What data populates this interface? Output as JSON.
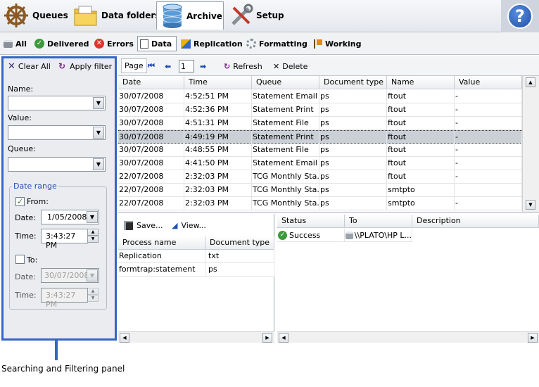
{
  "topbar": {
    "items": [
      {
        "label": "Queues",
        "icon": "ship-wheel-icon"
      },
      {
        "label": "Data folders",
        "icon": "folder-icon"
      },
      {
        "label": "Archive",
        "icon": "database-icon",
        "active": true
      },
      {
        "label": "Setup",
        "icon": "tools-icon"
      }
    ],
    "help_glyph": "?"
  },
  "tabs": [
    {
      "label": "All",
      "icon": "printer-icon"
    },
    {
      "label": "Delivered",
      "icon": "check-icon"
    },
    {
      "label": "Errors",
      "icon": "error-icon"
    },
    {
      "label": "Data",
      "icon": "data-icon",
      "active": true
    },
    {
      "label": "Replication",
      "icon": "replication-icon"
    },
    {
      "label": "Formatting",
      "icon": "gear-icon"
    },
    {
      "label": "Working",
      "icon": "flag-icon"
    }
  ],
  "filter": {
    "clear_all": "Clear All",
    "apply_filter": "Apply filter",
    "name_label": "Name:",
    "value_label": "Value:",
    "queue_label": "Queue:",
    "date_range_title": "Date range",
    "from_label": "From:",
    "from_checked": true,
    "from_date_label": "Date:",
    "from_date": "1/05/2008",
    "from_time_label": "Time:",
    "from_time": "3:43:27 PM",
    "to_label": "To:",
    "to_checked": false,
    "to_date_label": "Date:",
    "to_date": "30/07/2008",
    "to_time_label": "Time:",
    "to_time": "3:43:27 PM"
  },
  "data_toolbar": {
    "page_label": "Page",
    "page_value": "1",
    "refresh": "Refresh",
    "delete": "Delete"
  },
  "grid": {
    "columns": [
      "Date",
      "Time",
      "Queue",
      "Document type",
      "Name",
      "Value"
    ],
    "rows": [
      [
        "30/07/2008",
        "4:52:51 PM",
        "Statement Email",
        "ps",
        "ftout",
        "-"
      ],
      [
        "30/07/2008",
        "4:52:36 PM",
        "Statement Print",
        "ps",
        "ftout",
        "-"
      ],
      [
        "30/07/2008",
        "4:51:31 PM",
        "Statement File",
        "ps",
        "ftout",
        "-"
      ],
      [
        "30/07/2008",
        "4:49:19 PM",
        "Statement Print",
        "ps",
        "ftout",
        "-"
      ],
      [
        "30/07/2008",
        "4:48:55 PM",
        "Statement File",
        "ps",
        "ftout",
        "-"
      ],
      [
        "30/07/2008",
        "4:41:50 PM",
        "Statement Email",
        "ps",
        "ftout",
        "-"
      ],
      [
        "22/07/2008",
        "2:32:03 PM",
        "TCG Monthly Sta...",
        "ps",
        "ftout",
        "-"
      ],
      [
        "22/07/2008",
        "2:32:03 PM",
        "TCG Monthly Sta...",
        "ps",
        "smtpto",
        ""
      ],
      [
        "22/07/2008",
        "2:32:03 PM",
        "TCG Monthly Sta...",
        "ps",
        "smtpto",
        "-"
      ]
    ],
    "selected_row": 3
  },
  "process": {
    "save": "Save...",
    "view": "View...",
    "columns": [
      "Process name",
      "Document type"
    ],
    "rows": [
      [
        "Replication",
        "txt"
      ],
      [
        "formtrap:statement",
        "ps"
      ]
    ]
  },
  "status_pane": {
    "columns": [
      "Status",
      "To",
      "Description"
    ],
    "rows": [
      [
        "Success",
        "\\\\PLATO\\HP L...",
        ""
      ]
    ]
  },
  "caption": "Searching and Filtering panel",
  "colors": {
    "accent": "#3565c8",
    "selected_row": "#cbcfd6"
  }
}
